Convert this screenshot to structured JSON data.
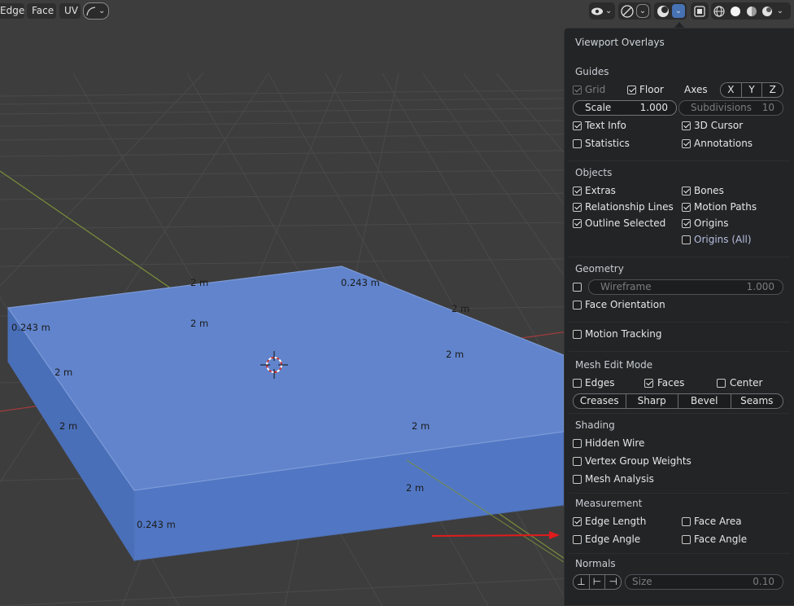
{
  "header": {
    "edge_label": "Edge",
    "face_label": "Face",
    "uv_label": "UV"
  },
  "viewport": {
    "measurements": {
      "m1": "2 m",
      "m2": "0.243 m",
      "m3": "0.243 m",
      "m4": "2 m",
      "m5": "2 m",
      "m6": "2 m",
      "m7": "2 m",
      "m8": "2 m",
      "m9": "2 m",
      "m10": "2 m",
      "m11": "2 m",
      "m12": "0.243 m"
    },
    "colors": {
      "mesh": "#5b82cf",
      "x_axis": "#a23b3b",
      "y_axis": "#7a8e3a",
      "annotation_arrow": "#e01b1b"
    }
  },
  "overlays": {
    "title": "Viewport Overlays",
    "guides": {
      "heading": "Guides",
      "grid": "Grid",
      "floor": "Floor",
      "axes": "Axes",
      "x": "X",
      "y": "Y",
      "z": "Z",
      "scale_label": "Scale",
      "scale_value": "1.000",
      "subdivisions_label": "Subdivisions",
      "subdivisions_value": "10",
      "text_info": "Text Info",
      "cursor": "3D Cursor",
      "statistics": "Statistics",
      "annotations": "Annotations"
    },
    "objects": {
      "heading": "Objects",
      "extras": "Extras",
      "bones": "Bones",
      "relationship_lines": "Relationship Lines",
      "motion_paths": "Motion Paths",
      "outline_selected": "Outline Selected",
      "origins": "Origins",
      "origins_all": "Origins (All)"
    },
    "geometry": {
      "heading": "Geometry",
      "wireframe_label": "Wireframe",
      "wireframe_value": "1.000",
      "face_orientation": "Face Orientation"
    },
    "motion_tracking": "Motion Tracking",
    "mesh_edit": {
      "heading": "Mesh Edit Mode",
      "edges": "Edges",
      "faces": "Faces",
      "center": "Center",
      "creases": "Creases",
      "sharp": "Sharp",
      "bevel": "Bevel",
      "seams": "Seams"
    },
    "shading": {
      "heading": "Shading",
      "hidden_wire": "Hidden Wire",
      "vertex_group_weights": "Vertex Group Weights",
      "mesh_analysis": "Mesh Analysis"
    },
    "measurement": {
      "heading": "Measurement",
      "edge_length": "Edge Length",
      "face_area": "Face Area",
      "edge_angle": "Edge Angle",
      "face_angle": "Face Angle"
    },
    "normals": {
      "heading": "Normals",
      "size_label": "Size",
      "size_value": "0.10"
    }
  }
}
